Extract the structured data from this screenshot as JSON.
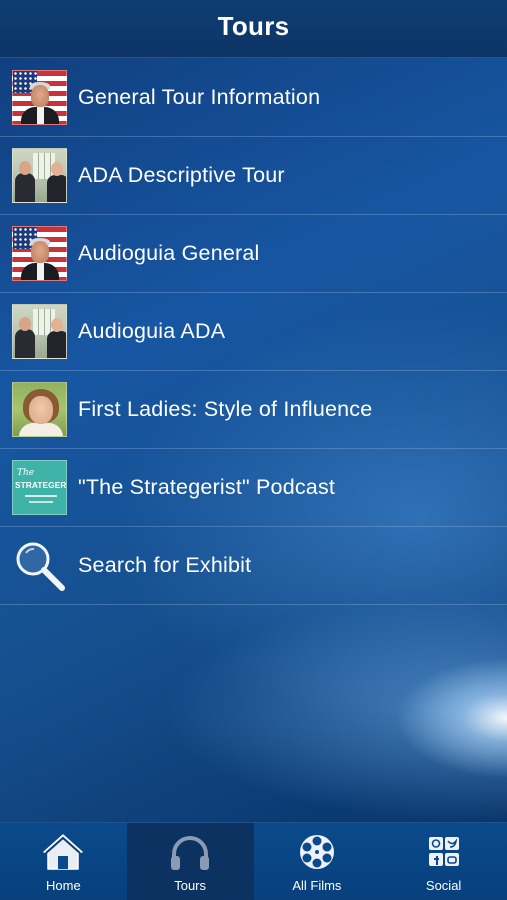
{
  "header": {
    "title": "Tours"
  },
  "tours": [
    {
      "label": "General Tour Information",
      "thumb": "flag",
      "icon": "president-flag-photo"
    },
    {
      "label": "ADA Descriptive Tour",
      "thumb": "office",
      "icon": "oval-office-photo"
    },
    {
      "label": "Audioguia General",
      "thumb": "flag",
      "icon": "president-flag-photo"
    },
    {
      "label": "Audioguia ADA",
      "thumb": "office",
      "icon": "oval-office-photo"
    },
    {
      "label": "First Ladies: Style of Influence",
      "thumb": "lady",
      "icon": "first-lady-photo"
    },
    {
      "label": "\"The Strategerist\" Podcast",
      "thumb": "podcast",
      "icon": "strategerist-podcast-logo"
    },
    {
      "label": "Search for Exhibit",
      "thumb": "search",
      "icon": "magnifier-icon"
    }
  ],
  "podcast_logo": {
    "line1": "The",
    "line2": "STRATEGERIST"
  },
  "tabbar": [
    {
      "label": "Home",
      "icon": "house-icon",
      "active": false
    },
    {
      "label": "Tours",
      "icon": "headphones-icon",
      "active": true
    },
    {
      "label": "All Films",
      "icon": "film-reel-icon",
      "active": false
    },
    {
      "label": "Social",
      "icon": "social-grid-icon",
      "active": false
    }
  ],
  "colors": {
    "header": "#0f3d72",
    "tab_active": "#0b3260",
    "tabbar": "#0a4a8c",
    "podcast_teal": "#3fb3a8"
  }
}
